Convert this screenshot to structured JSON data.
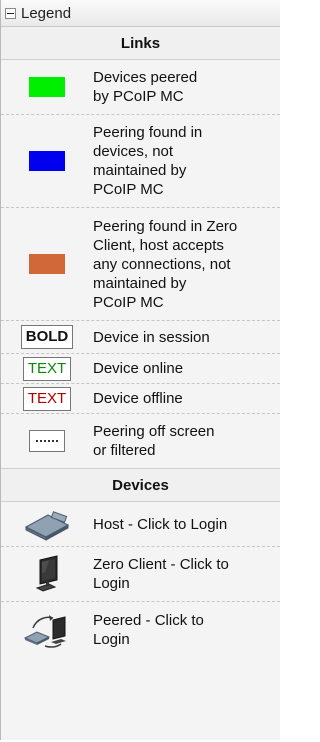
{
  "legend": {
    "title": "Legend",
    "links_header": "Links",
    "devices_header": "Devices",
    "links": [
      {
        "type": "swatch",
        "color": "#00ee00",
        "icon": "green-swatch",
        "label": "Devices peered\nby PCoIP MC"
      },
      {
        "type": "swatch",
        "color": "#0000ee",
        "icon": "blue-swatch",
        "label": "Peering found in\ndevices, not\nmaintained by\nPCoIP MC"
      },
      {
        "type": "swatch",
        "color": "#d0683a",
        "icon": "orange-swatch",
        "label": "Peering found in Zero\nClient, host accepts\nany connections, not\nmaintained by\nPCoIP MC"
      },
      {
        "type": "badge",
        "badge_text": "BOLD",
        "label": "Device in session"
      },
      {
        "type": "badge",
        "badge_text": "TEXT",
        "badge_color": "#0a8a0a",
        "label": "Device online"
      },
      {
        "type": "badge",
        "badge_text": "TEXT",
        "badge_color": "#b00000",
        "label": "Device offline"
      },
      {
        "type": "dotted",
        "icon": "dotted-line",
        "label": "Peering off screen\nor filtered"
      }
    ],
    "devices": [
      {
        "icon": "host-device-icon",
        "label": "Host - Click to Login"
      },
      {
        "icon": "zero-client-monitor-icon",
        "label": "Zero Client - Click to\nLogin"
      },
      {
        "icon": "peered-devices-icon",
        "label": "Peered - Click to\nLogin"
      }
    ]
  }
}
